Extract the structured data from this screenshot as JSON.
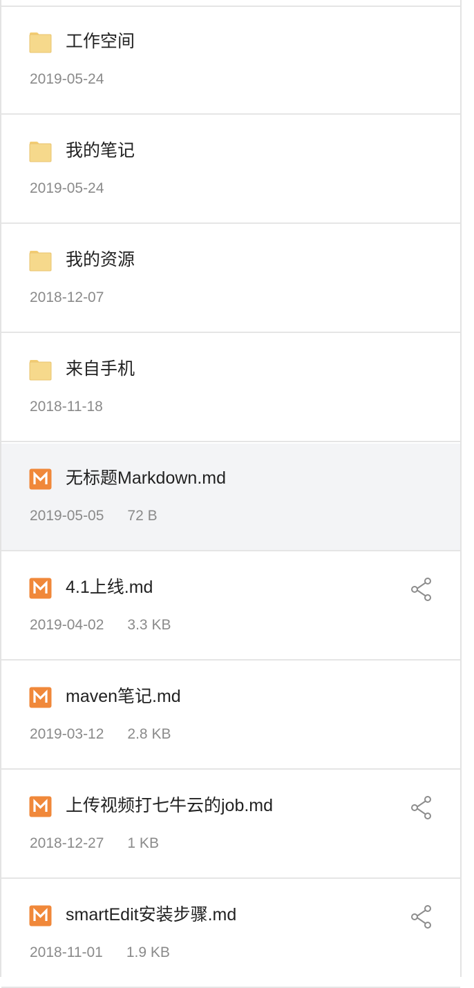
{
  "files": [
    {
      "name": "工作空间",
      "date": "2019-05-24",
      "size": "",
      "kind": "folder",
      "icon": "folder-icon",
      "selected": false,
      "share": false
    },
    {
      "name": "我的笔记",
      "date": "2019-05-24",
      "size": "",
      "kind": "folder",
      "icon": "folder-icon",
      "selected": false,
      "share": false
    },
    {
      "name": "我的资源",
      "date": "2018-12-07",
      "size": "",
      "kind": "folder",
      "icon": "folder-icon",
      "selected": false,
      "share": false
    },
    {
      "name": "来自手机",
      "date": "2018-11-18",
      "size": "",
      "kind": "folder",
      "icon": "folder-icon",
      "selected": false,
      "share": false
    },
    {
      "name": "无标题Markdown.md",
      "date": "2019-05-05",
      "size": "72 B",
      "kind": "markdown",
      "icon": "markdown-file-icon",
      "selected": true,
      "share": false
    },
    {
      "name": "4.1上线.md",
      "date": "2019-04-02",
      "size": "3.3 KB",
      "kind": "markdown",
      "icon": "markdown-file-icon",
      "selected": false,
      "share": true
    },
    {
      "name": "maven笔记.md",
      "date": "2019-03-12",
      "size": "2.8 KB",
      "kind": "markdown",
      "icon": "markdown-file-icon",
      "selected": false,
      "share": false
    },
    {
      "name": "上传视频打七牛云的job.md",
      "date": "2018-12-27",
      "size": "1 KB",
      "kind": "markdown",
      "icon": "markdown-file-icon",
      "selected": false,
      "share": true
    },
    {
      "name": "smartEdit安装步骤.md",
      "date": "2018-11-01",
      "size": "1.9 KB",
      "kind": "markdown",
      "icon": "markdown-file-icon",
      "selected": false,
      "share": true
    }
  ],
  "icons": {
    "folder": "folder-icon",
    "markdown": "markdown-file-icon",
    "share": "share-icon"
  },
  "colors": {
    "folder_fill": "#f6d98c",
    "folder_tab": "#f3cd73",
    "markdown_orange": "#f0883a",
    "share_stroke": "#8c8c8c",
    "selected_row_bg": "#f3f4f6",
    "divider": "#e5e5e5",
    "name_text": "#222222",
    "meta_text": "#8a8a8a"
  }
}
